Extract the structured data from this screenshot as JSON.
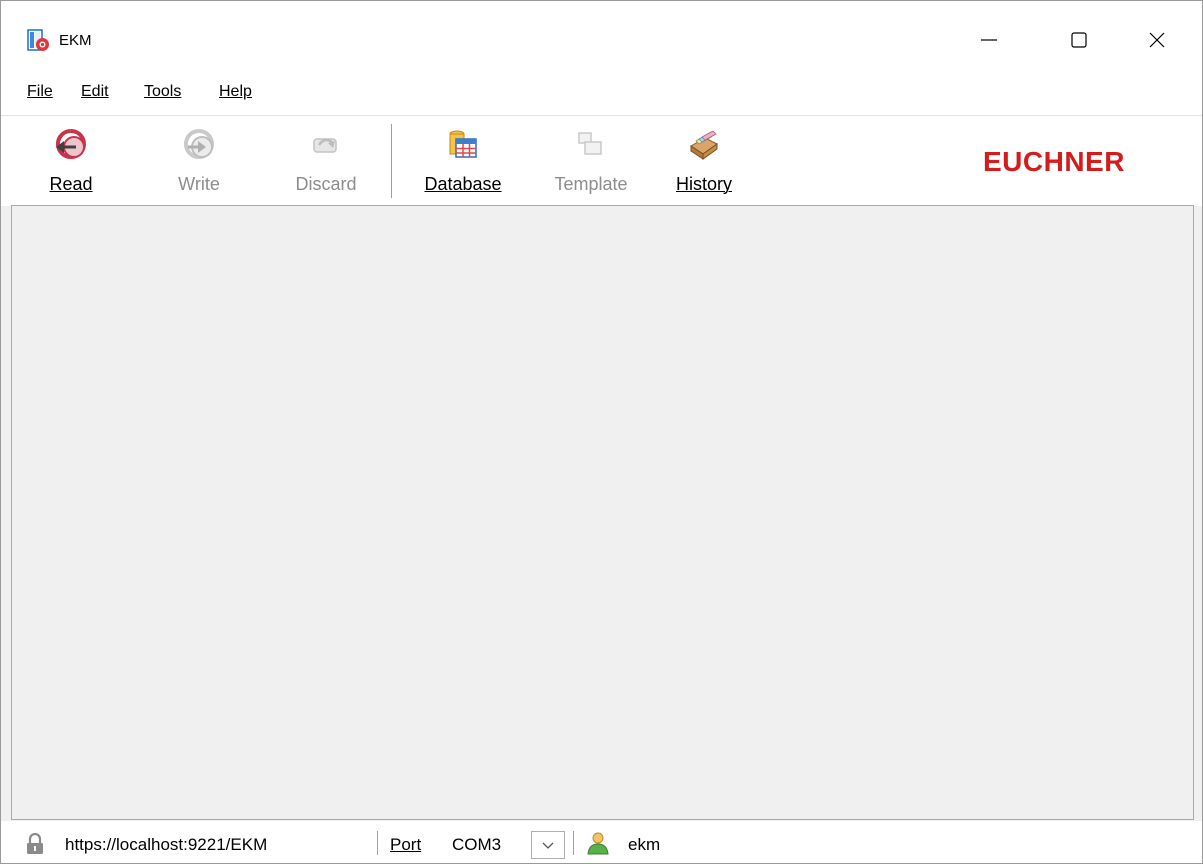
{
  "window": {
    "title": "EKM",
    "app_icon": "ekm-app-icon"
  },
  "menu": {
    "file": "File",
    "edit": "Edit",
    "tools": "Tools",
    "help": "Help"
  },
  "toolbar": {
    "read": "Read",
    "write": "Write",
    "discard": "Discard",
    "database": "Database",
    "template": "Template",
    "history": "History"
  },
  "brand": {
    "text": "EUCHNER",
    "color": "#d41c1c"
  },
  "status": {
    "url": "https://localhost:9221/EKM",
    "port_label": "Port",
    "port_value": "COM3",
    "user": "ekm"
  },
  "icons": [
    "ekm-app-icon",
    "minimize-icon",
    "maximize-icon",
    "close-icon",
    "read-icon",
    "write-icon",
    "discard-icon",
    "database-icon",
    "template-icon",
    "history-icon",
    "lock-icon",
    "chevron-down-icon",
    "user-icon"
  ]
}
